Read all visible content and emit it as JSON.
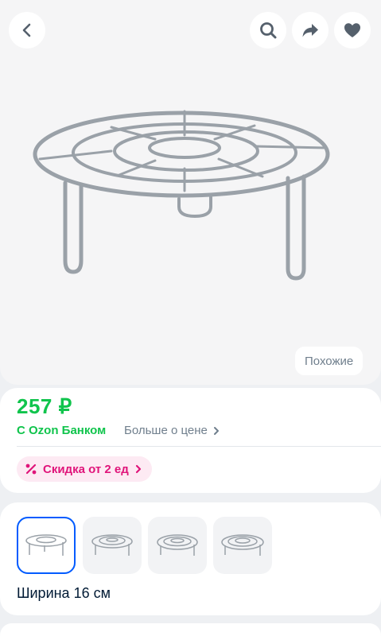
{
  "header": {
    "back_icon": "chevron-left-icon",
    "search_icon": "search-icon",
    "share_icon": "share-arrow-icon",
    "favorite_icon": "heart-icon"
  },
  "gallery": {
    "similar_label": "Похожие"
  },
  "price_block": {
    "price": "257 ₽",
    "bank_label": "С Ozon Банком",
    "more_label": "Больше о цене",
    "discount_label": "Скидка от 2 ед",
    "price_color": "#10c44c",
    "discount_color": "#e0147a"
  },
  "variants": {
    "label": "Ширина 16 см",
    "selected_border_color": "#005bff",
    "thumb_count_note": ""
  }
}
